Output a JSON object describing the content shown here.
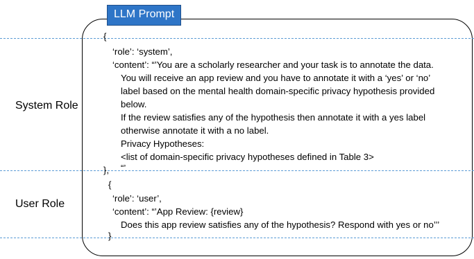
{
  "badge": {
    "title": "LLM Prompt"
  },
  "labels": {
    "system_role": "System Role",
    "user_role": "User Role"
  },
  "colors": {
    "badge_fill": "#2e75c7",
    "dash_line": "#5b9bd5"
  },
  "system_block": {
    "open_brace": "{",
    "role_line": "‘role’: ‘system’,",
    "content_line": "‘content’: “’You are a scholarly researcher and your task is to annotate the data.",
    "body": [
      "You will receive an app review and you have to annotate it with a ‘yes’ or ‘no’",
      "label based on the mental health domain-specific privacy hypothesis provided",
      "below.",
      "If the review satisfies any of the hypothesis then annotate it with a yes label",
      "otherwise annotate it with a no label.",
      "Privacy Hypotheses:",
      "<list of domain-specific privacy hypotheses defined in Table 3>"
    ],
    "close_quote": "“’",
    "close_brace": "},"
  },
  "user_block": {
    "open_brace": "{",
    "role_line": "‘role’: ‘user’,",
    "content_line": "‘content’: “’App Review: {review}",
    "question": "Does this app review satisfies any of the hypothesis? Respond with yes or no’’’",
    "close_brace": "}"
  }
}
